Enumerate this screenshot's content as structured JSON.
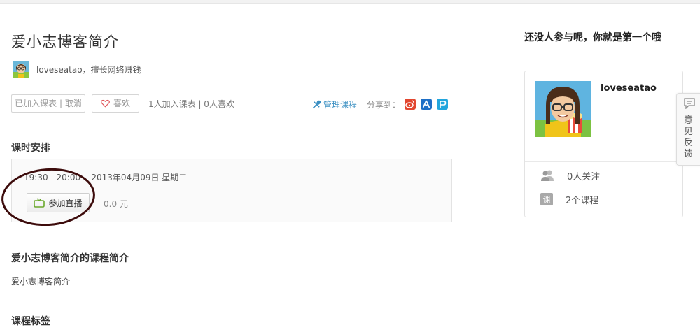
{
  "course": {
    "title": "爱小志博客简介",
    "teacher": "loveseatao，擅长网络赚钱"
  },
  "actions": {
    "joined_label": "已加入课表 | 取消",
    "like_label": "喜欢",
    "stats": "1人加入课表 | 0人喜欢",
    "manage_label": "管理课程",
    "share_label": "分享到：",
    "share_icons": [
      "weibo-icon",
      "renren-icon",
      "pengyou-icon"
    ]
  },
  "schedule": {
    "heading": "课时安排",
    "time": "19:30 - 20:00    2013年04月09日 星期二",
    "live_button": "参加直播",
    "price": "0.0 元"
  },
  "intro": {
    "heading": "爱小志博客简介的课程简介",
    "text": "爱小志博客简介"
  },
  "tags": {
    "heading": "课程标签"
  },
  "sidebar": {
    "title": "还没人参与呢，你就是第一个哦",
    "profile": {
      "name": "loveseatao",
      "followers": "0人关注",
      "courses": "2个课程",
      "course_icon_text": "课"
    }
  },
  "feedback": {
    "label": "意见反馈"
  },
  "colors": {
    "link": "#3a8fc2",
    "annotation_circle": "#3d0c0c"
  }
}
